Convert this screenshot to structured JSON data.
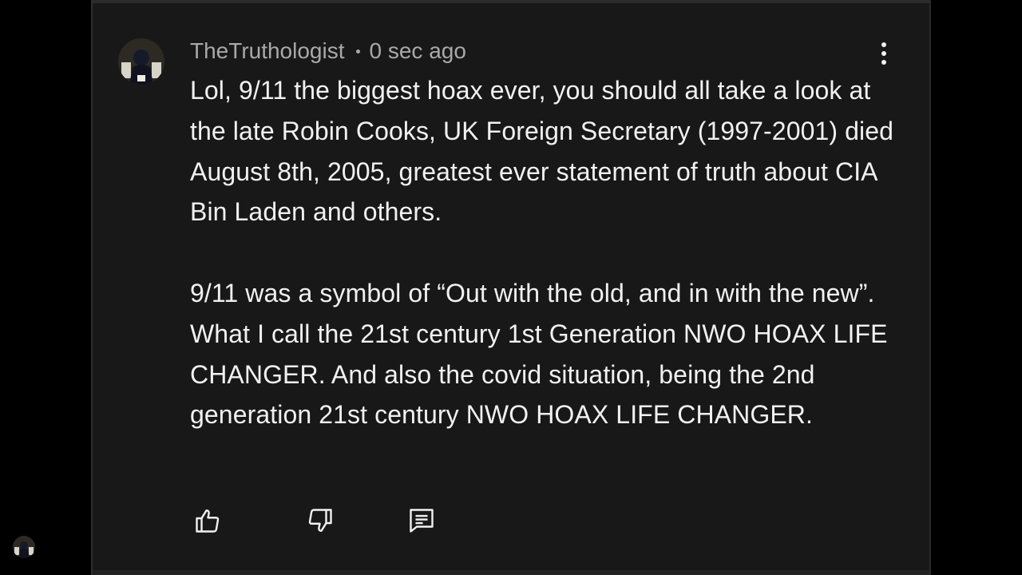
{
  "comment": {
    "author": "TheTruthologist",
    "timestamp": "0 sec ago",
    "avatar_icon": "user-avatar-icon",
    "paragraphs": [
      "Lol, 9/11 the biggest hoax ever, you should all take a look at the late Robin Cooks, UK Foreign Secretary (1997-2001) died August 8th, 2005, greatest ever statement of truth about CIA Bin Laden and others.",
      "9/11 was a symbol of “Out with the old, and in with the new”. What I call the 21st century 1st Generation NWO HOAX LIFE CHANGER. And also the covid situation, being the 2nd generation 21st century NWO HOAX LIFE CHANGER."
    ]
  },
  "actions": {
    "like_icon": "thumbs-up-icon",
    "dislike_icon": "thumbs-down-icon",
    "reply_icon": "reply-icon",
    "more_icon": "more-vertical-icon"
  },
  "colors": {
    "page_background": "#000000",
    "card_background": "#181818",
    "author_text": "#a9a9a9",
    "body_text": "#f1f1f1",
    "icon": "#f1f1f1"
  }
}
